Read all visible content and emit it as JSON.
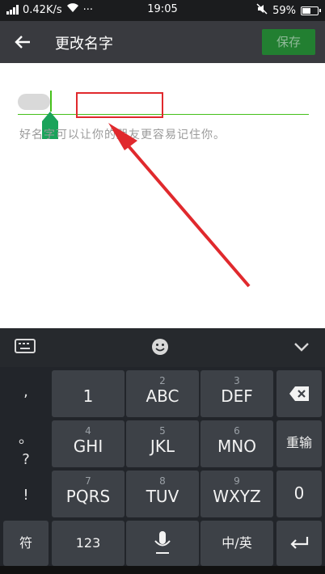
{
  "status_bar": {
    "network_speed": "0.42K/s",
    "time": "19:05",
    "battery": "59%",
    "battery_level": 0.59
  },
  "toolbar": {
    "back_icon": "arrow-left-icon",
    "title": "更改名字",
    "save_label": "保存"
  },
  "form": {
    "name_value": "",
    "hint": "好名字可以让你的朋友更容易记住你。"
  },
  "keyboard": {
    "punctuation": [
      ",",
      "。",
      "?",
      "!"
    ],
    "keys": [
      {
        "num": "",
        "label": "1"
      },
      {
        "num": "2",
        "label": "ABC"
      },
      {
        "num": "3",
        "label": "DEF"
      },
      {
        "num": "4",
        "label": "GHI"
      },
      {
        "num": "5",
        "label": "JKL"
      },
      {
        "num": "6",
        "label": "MNO"
      },
      {
        "num": "7",
        "label": "PQRS"
      },
      {
        "num": "8",
        "label": "TUV"
      },
      {
        "num": "9",
        "label": "WXYZ"
      }
    ],
    "enter_label": "重输",
    "zero_label": "0",
    "symbol_label": "符",
    "numeric_label": "123",
    "lang_label": "中/英"
  },
  "colors": {
    "accent": "#45c01a",
    "annotation": "#e0292d",
    "toolbar": "#393a3f"
  }
}
